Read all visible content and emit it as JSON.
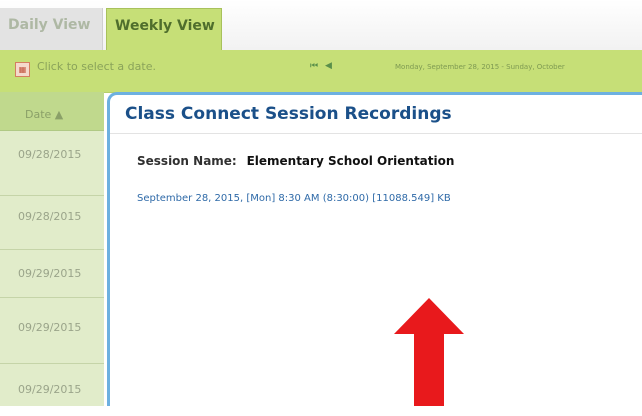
{
  "tabs": [
    {
      "label": "Daily View",
      "active": false
    },
    {
      "label": "Weekly View",
      "active": true
    }
  ],
  "toolbar": {
    "click_text": "Click to select a date.",
    "nav_arrows": "⏮ ◀",
    "range_text": "Monday, September 28, 2015 - Sunday, October"
  },
  "date_column": {
    "header": "Date ▲",
    "rows": [
      "09/28/2015",
      "09/28/2015",
      "09/29/2015",
      "09/29/2015",
      "09/29/2015"
    ]
  },
  "dialog": {
    "title": "Class Connect Session Recordings",
    "session_label": "Session Name:",
    "session_name": "Elementary School Orientation",
    "recording_link": "September 28, 2015, [Mon] 8:30 AM (8:30:00)  [11088.549] KB"
  },
  "colors": {
    "toolbar_green": "#c6df77",
    "dialog_border": "#6db0e0",
    "title_blue": "#1b5089",
    "link_blue": "#2f6aa8",
    "arrow_red": "#e8191c"
  },
  "icons": {
    "calendar": "calendar-icon",
    "arrow": "red-up-arrow-annotation"
  }
}
